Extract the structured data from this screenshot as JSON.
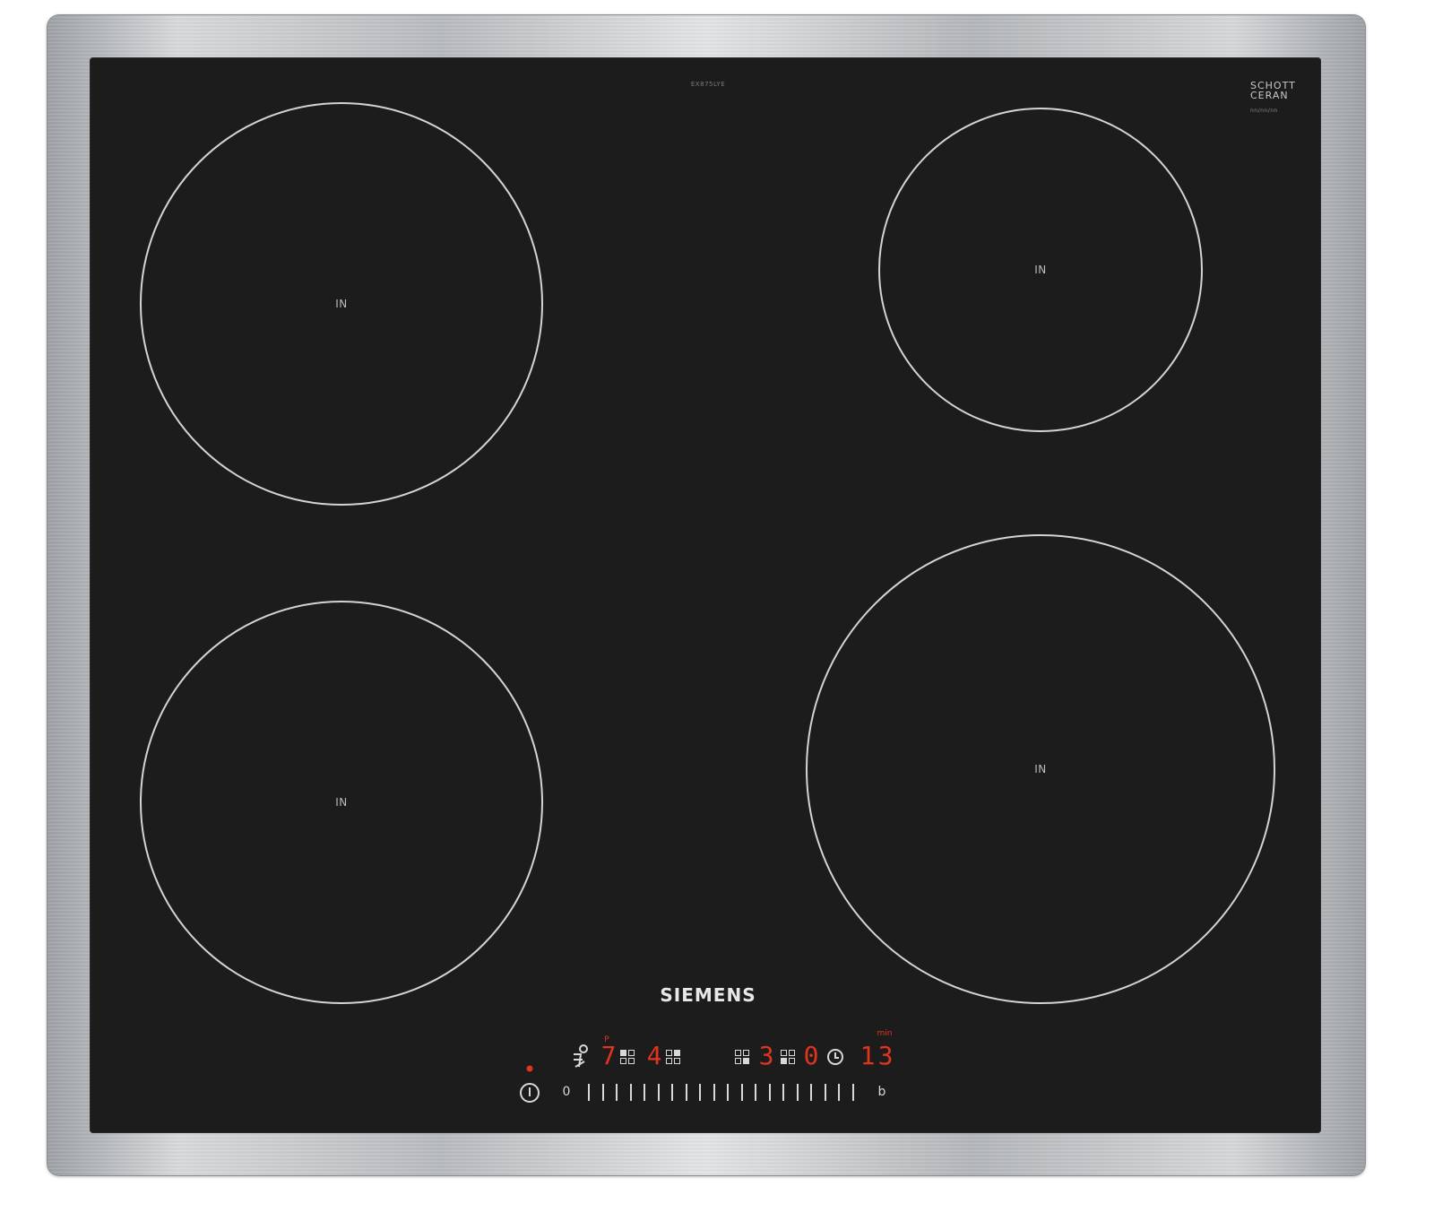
{
  "cooktop": {
    "model_code": "EX875LYE",
    "glass_brand_line1": "SCHOTT",
    "glass_brand_line2": "CERAN",
    "glass_brand_line3": "nn/nn/nn",
    "brand": "SIEMENS",
    "zones": [
      {
        "id": "rear-left",
        "label": "IN"
      },
      {
        "id": "rear-right",
        "label": "IN"
      },
      {
        "id": "front-left",
        "label": "IN"
      },
      {
        "id": "front-right",
        "label": "IN"
      }
    ]
  },
  "control_panel": {
    "display_1": "7",
    "display_2": "4",
    "display_3": "3",
    "display_4": "0",
    "timer_display_1": "1",
    "timer_display_2": "3",
    "timer_unit": "min",
    "slider_start": "0",
    "slider_end": "b",
    "power_indicator_color": "#e0341e",
    "display_color": "#e0341e"
  }
}
